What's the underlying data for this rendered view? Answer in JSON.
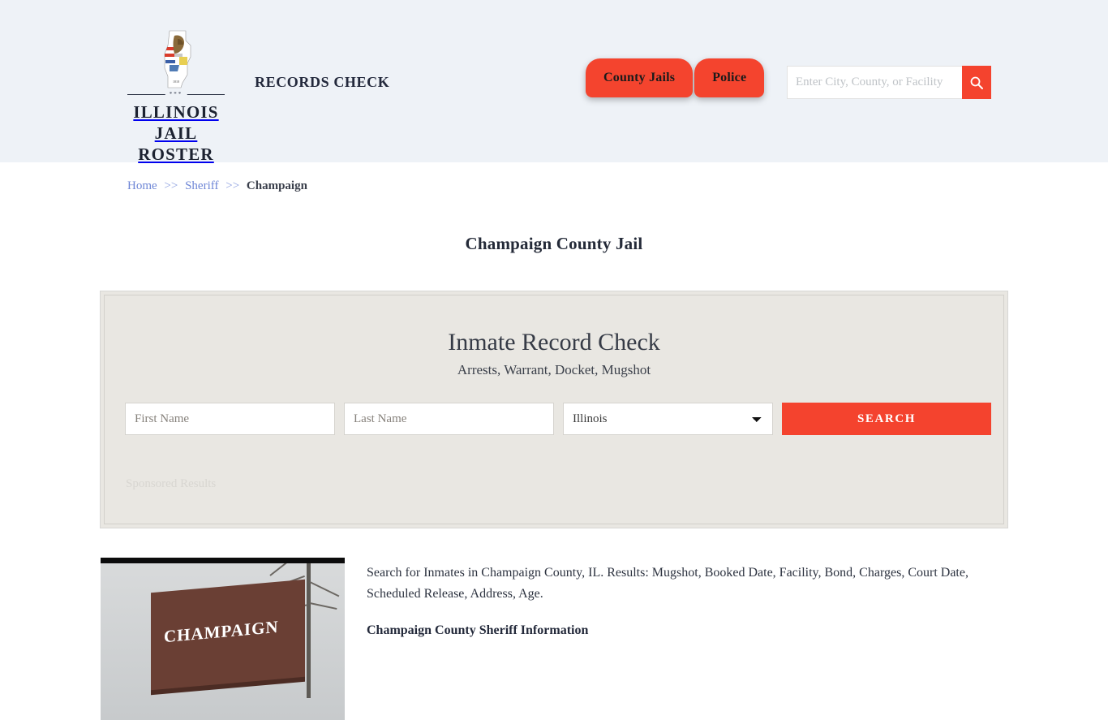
{
  "header": {
    "brand": {
      "logo_icon": "illinois-state-outline-flag-icon",
      "rule_marker": "***",
      "line1": "ILLINOIS",
      "line2": "JAIL ROSTER"
    },
    "tagline": "RECORDS CHECK",
    "nav": [
      {
        "label": "County Jails"
      },
      {
        "label": "Police"
      }
    ],
    "search": {
      "placeholder": "Enter City, County, or Facility",
      "value": "",
      "button_icon": "search-icon"
    },
    "accent_color": "#f4432e",
    "background_color": "#eef2f7"
  },
  "breadcrumb": {
    "home": "Home",
    "sheriff": "Sheriff",
    "separator": ">>",
    "current": "Champaign"
  },
  "page_title": "Champaign County Jail",
  "search_panel": {
    "heading": "Inmate Record Check",
    "subheading": "Arrests, Warrant, Docket, Mugshot",
    "first_name_placeholder": "First Name",
    "first_name_value": "",
    "last_name_placeholder": "Last Name",
    "last_name_value": "",
    "state_selected": "Illinois",
    "state_options": [
      "Illinois"
    ],
    "search_button": "SEARCH",
    "sponsored_label": "Sponsored Results",
    "background_color": "#e9e7e2"
  },
  "content": {
    "thumbnail": {
      "alt": "champaign-county-sign-photo",
      "sign_text": "CHAMPAIGN"
    },
    "description": "Search for Inmates in Champaign County, IL. Results: Mugshot, Booked Date, Facility, Bond, Charges, Court Date, Scheduled Release, Address, Age.",
    "subheading": "Champaign County Sheriff Information"
  }
}
